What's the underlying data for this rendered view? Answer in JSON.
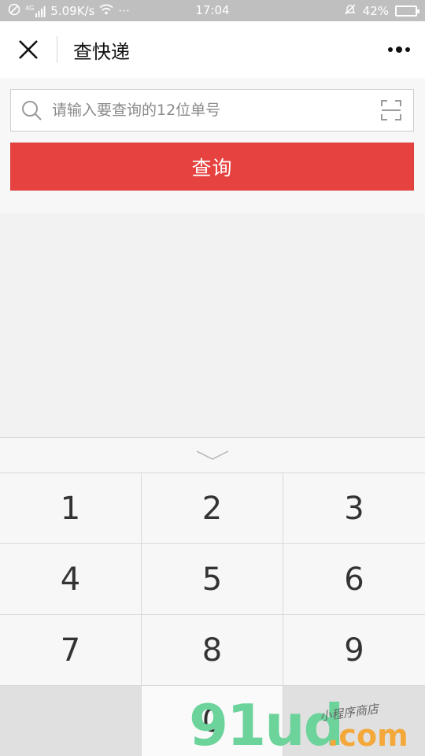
{
  "status_bar": {
    "network_label": "4G",
    "speed": "5.09K/s",
    "dots": "···",
    "time": "17:04",
    "battery_percent": "42%",
    "battery_level": 0.42
  },
  "nav": {
    "title": "查快递"
  },
  "search": {
    "placeholder": "请输入要查询的12位单号",
    "value": ""
  },
  "query_button": {
    "label": "查询",
    "color": "#e64340"
  },
  "keypad": {
    "keys": [
      "1",
      "2",
      "3",
      "4",
      "5",
      "6",
      "7",
      "8",
      "9",
      "",
      "0",
      ""
    ]
  },
  "watermark": {
    "text": "91ud",
    "suffix": ".com",
    "signature": "小程序商店"
  }
}
